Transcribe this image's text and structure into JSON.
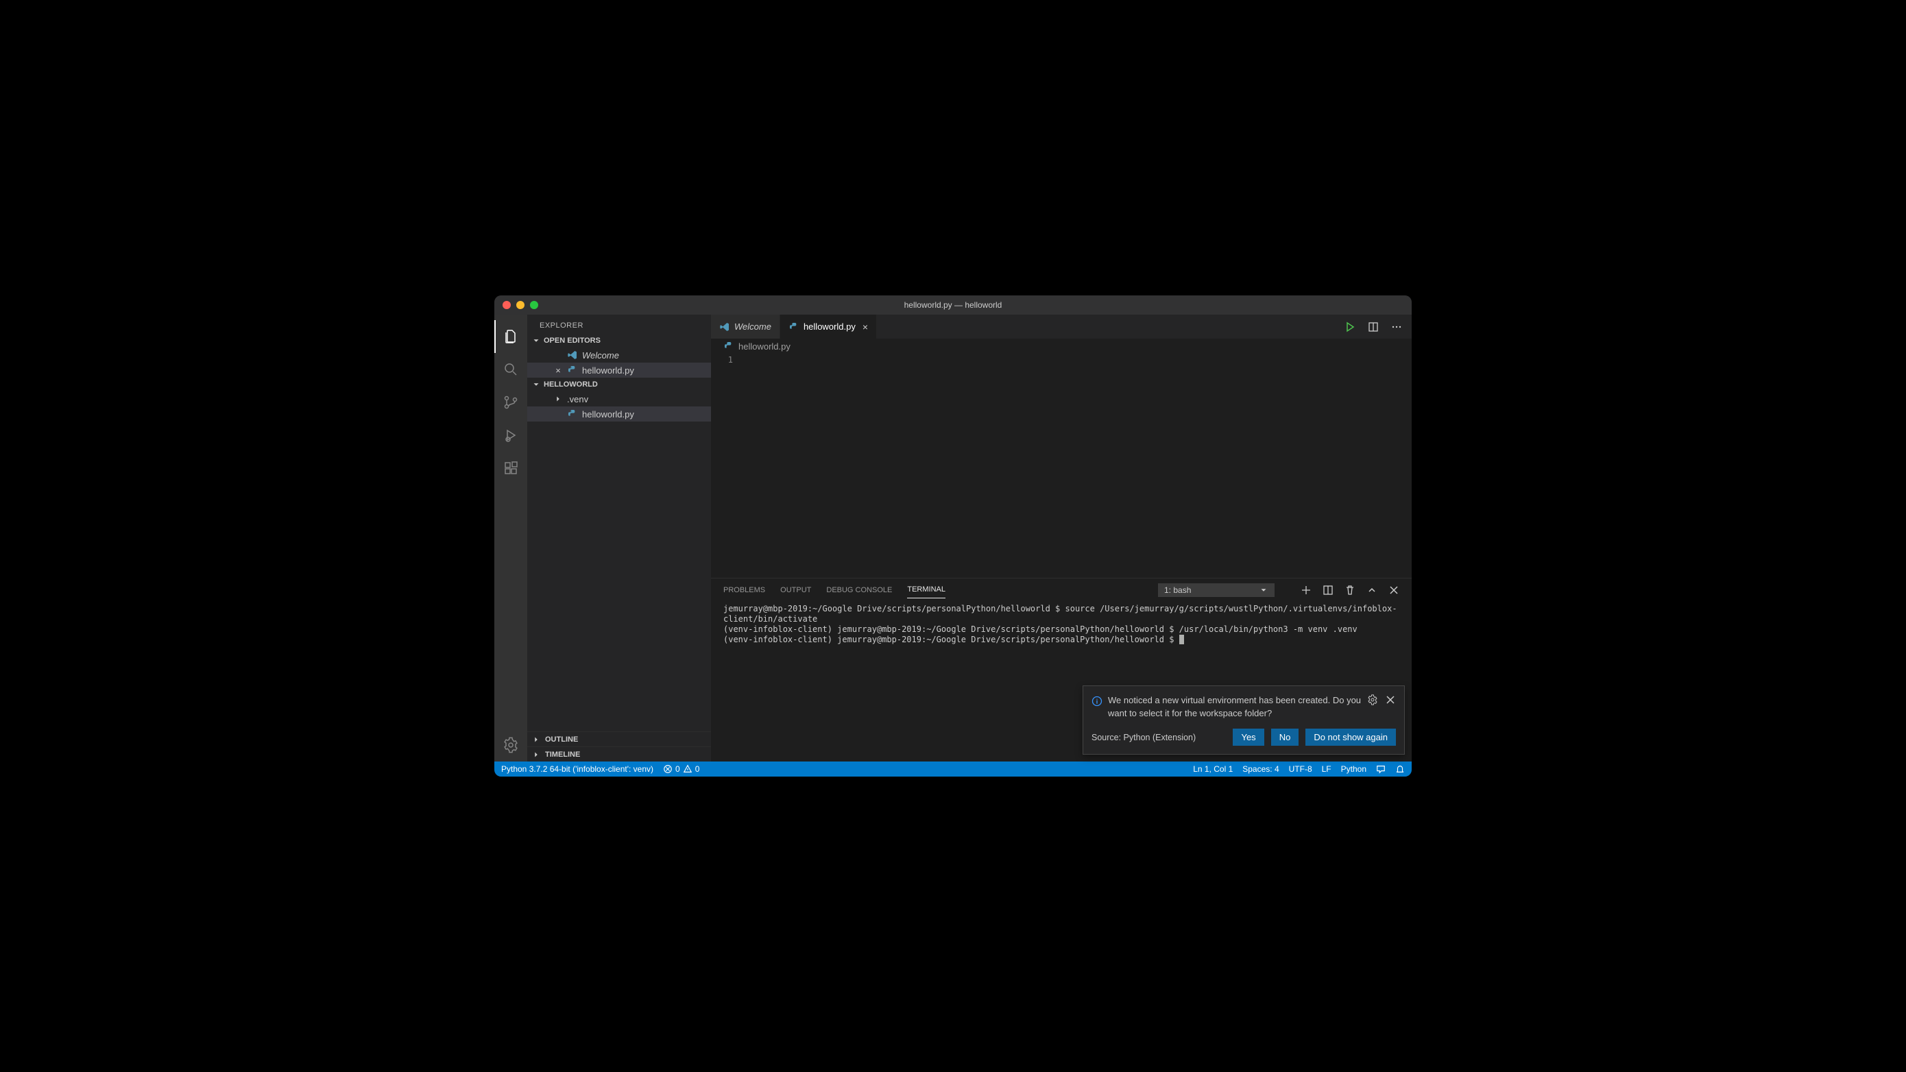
{
  "window": {
    "title": "helloworld.py — helloworld"
  },
  "sidebar": {
    "title": "EXPLORER",
    "openEditorsLabel": "OPEN EDITORS",
    "openEditors": [
      {
        "name": "Welcome",
        "italic": true,
        "modified": false
      },
      {
        "name": "helloworld.py",
        "italic": false,
        "modified": false
      }
    ],
    "workspaceLabel": "HELLOWORLD",
    "files": [
      {
        "name": ".venv",
        "type": "folder"
      },
      {
        "name": "helloworld.py",
        "type": "file",
        "selected": true
      }
    ],
    "outlineLabel": "OUTLINE",
    "timelineLabel": "TIMELINE"
  },
  "tabs": {
    "items": [
      {
        "label": "Welcome",
        "active": false,
        "italic": true,
        "icon": "vscode"
      },
      {
        "label": "helloworld.py",
        "active": true,
        "italic": false,
        "icon": "python"
      }
    ]
  },
  "breadcrumb": {
    "file": "helloworld.py"
  },
  "editor": {
    "lineNumbers": [
      "1"
    ]
  },
  "panel": {
    "tabs": [
      "PROBLEMS",
      "OUTPUT",
      "DEBUG CONSOLE",
      "TERMINAL"
    ],
    "activeTab": "TERMINAL",
    "terminalSelect": "1: bash",
    "terminalLines": [
      "jemurray@mbp-2019:~/Google Drive/scripts/personalPython/helloworld $ source /Users/jemurray/g/scripts/wustlPython/.virtualenvs/infoblox-client/bin/activate",
      "(venv-infoblox-client) jemurray@mbp-2019:~/Google Drive/scripts/personalPython/helloworld $ /usr/local/bin/python3 -m venv .venv",
      "(venv-infoblox-client) jemurray@mbp-2019:~/Google Drive/scripts/personalPython/helloworld $ "
    ]
  },
  "notification": {
    "message": "We noticed a new virtual environment has been created. Do you want to select it for the workspace folder?",
    "source": "Source: Python (Extension)",
    "buttons": {
      "yes": "Yes",
      "no": "No",
      "dontShow": "Do not show again"
    }
  },
  "statusbar": {
    "python": "Python 3.7.2 64-bit ('infoblox-client': venv)",
    "errors": "0",
    "warnings": "0",
    "cursor": "Ln 1, Col 1",
    "spaces": "Spaces: 4",
    "encoding": "UTF-8",
    "eol": "LF",
    "lang": "Python"
  }
}
